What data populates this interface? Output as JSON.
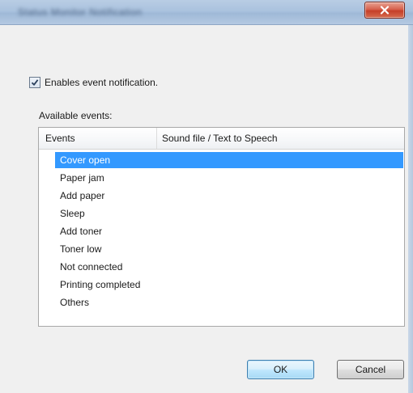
{
  "window": {
    "title": "Status Monitor Notification"
  },
  "notification": {
    "checkbox_label": "Enables event notification.",
    "checked": true
  },
  "events": {
    "label": "Available events:",
    "columns": [
      "Events",
      "Sound file / Text to Speech"
    ],
    "rows": [
      "Cover open",
      "Paper jam",
      "Add paper",
      "Sleep",
      "Add toner",
      "Toner low",
      "Not connected",
      "Printing completed",
      "Others"
    ],
    "selected_index": 0
  },
  "buttons": {
    "ok_label": "OK",
    "cancel_label": "Cancel"
  },
  "colors": {
    "selection": "#3399ff",
    "close_button": "#c53f28",
    "title_bar": "#aac2de"
  }
}
